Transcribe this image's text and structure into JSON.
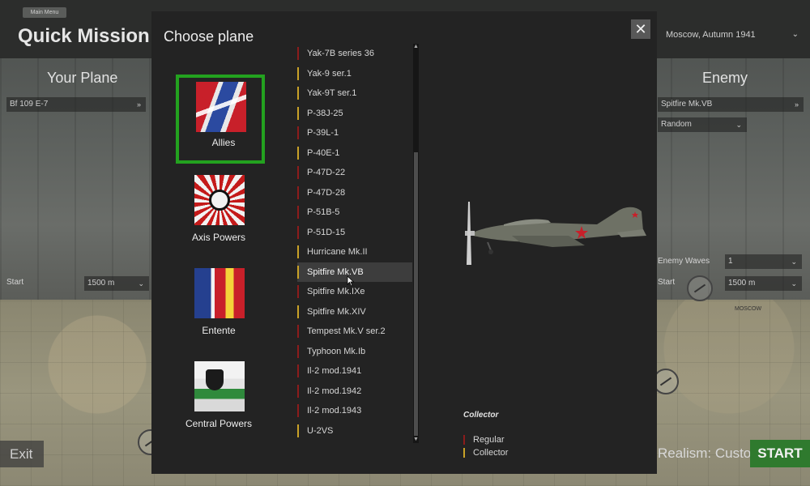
{
  "background": {
    "main_menu_label": "Main Menu",
    "title": "Quick Mission",
    "season_select": "Moscow, Autumn 1941",
    "your_plane_heading": "Your Plane",
    "enemy_heading": "Enemy",
    "your_plane_select": "Bf 109 E-7",
    "enemy_plane_select": "Spitfire Mk.VB",
    "enemy_mode_select": "Random",
    "waves_label": "Enemy Waves",
    "waves_value": "1",
    "start_label": "Start",
    "altitude_left": "1500 m",
    "altitude_right": "1500 m",
    "map_label": "MOSCOW",
    "exit_label": "Exit",
    "realism_label": "Realism: Custom",
    "start_button": "START"
  },
  "modal": {
    "title": "Choose plane",
    "close_label": "✕",
    "factions": [
      {
        "label": "Allies",
        "selected": true
      },
      {
        "label": "Axis Powers",
        "selected": false
      },
      {
        "label": "Entente",
        "selected": false
      },
      {
        "label": "Central Powers",
        "selected": false
      }
    ],
    "planes": [
      {
        "name": "Yak-7B series 36",
        "type": "regular"
      },
      {
        "name": "Yak-9 ser.1",
        "type": "collector"
      },
      {
        "name": "Yak-9T ser.1",
        "type": "collector"
      },
      {
        "name": "P-38J-25",
        "type": "collector"
      },
      {
        "name": "P-39L-1",
        "type": "regular"
      },
      {
        "name": "P-40E-1",
        "type": "collector"
      },
      {
        "name": "P-47D-22",
        "type": "regular"
      },
      {
        "name": "P-47D-28",
        "type": "regular"
      },
      {
        "name": "P-51B-5",
        "type": "regular"
      },
      {
        "name": "P-51D-15",
        "type": "regular"
      },
      {
        "name": "Hurricane Mk.II",
        "type": "collector"
      },
      {
        "name": "Spitfire Mk.VB",
        "type": "collector",
        "selected": true
      },
      {
        "name": "Spitfire Mk.IXe",
        "type": "regular"
      },
      {
        "name": "Spitfire Mk.XIV",
        "type": "collector"
      },
      {
        "name": "Tempest Mk.V ser.2",
        "type": "regular"
      },
      {
        "name": "Typhoon Mk.Ib",
        "type": "regular"
      },
      {
        "name": "Il-2 mod.1941",
        "type": "regular"
      },
      {
        "name": "Il-2 mod.1942",
        "type": "regular"
      },
      {
        "name": "Il-2 mod.1943",
        "type": "regular"
      },
      {
        "name": "U-2VS",
        "type": "collector"
      }
    ],
    "legend": {
      "title": "Collector",
      "regular_label": "Regular",
      "collector_label": "Collector"
    },
    "colors": {
      "regular": "#8c1c1c",
      "collector": "#c9a227",
      "selected_border": "#23a21f",
      "start_button": "#2f7a2e"
    }
  }
}
